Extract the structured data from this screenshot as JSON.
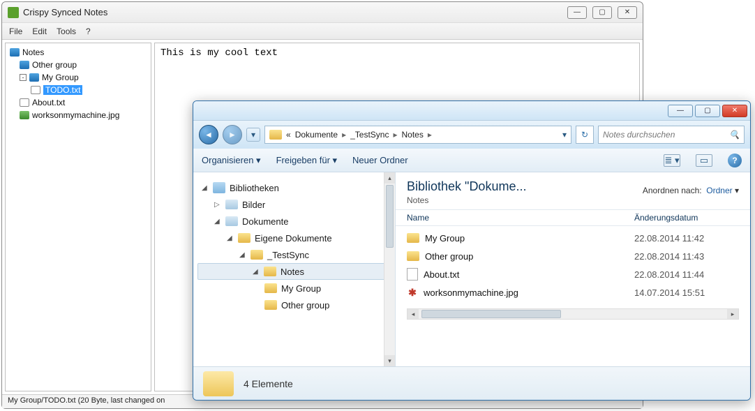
{
  "app": {
    "title": "Crispy Synced Notes",
    "menu": {
      "file": "File",
      "edit": "Edit",
      "tools": "Tools",
      "help": "?"
    },
    "tree": {
      "root": "Notes",
      "items": [
        {
          "label": "Other group"
        },
        {
          "label": "My Group"
        },
        {
          "label": "TODO.txt",
          "selected": true
        },
        {
          "label": "About.txt"
        },
        {
          "label": "worksonmymachine.jpg"
        }
      ]
    },
    "editor_text": "This is my cool text",
    "status": "My Group/TODO.txt (20 Byte, last changed on"
  },
  "explorer": {
    "breadcrumb": {
      "prefix": "«",
      "p1": "Dokumente",
      "p2": "_TestSync",
      "p3": "Notes"
    },
    "search_placeholder": "Notes durchsuchen",
    "toolbar": {
      "organize": "Organisieren",
      "share": "Freigeben für",
      "newfolder": "Neuer Ordner"
    },
    "nav_tree": {
      "libraries": "Bibliotheken",
      "pictures": "Bilder",
      "documents": "Dokumente",
      "own_docs": "Eigene Dokumente",
      "testsync": "_TestSync",
      "notes": "Notes",
      "mygroup": "My Group",
      "othergroup": "Other group"
    },
    "list": {
      "title": "Bibliothek \"Dokume...",
      "subtitle": "Notes",
      "sort_label": "Anordnen nach:",
      "sort_value": "Ordner",
      "col_name": "Name",
      "col_date": "Änderungsdatum",
      "rows": [
        {
          "name": "My Group",
          "date": "22.08.2014 11:42",
          "type": "folder"
        },
        {
          "name": "Other group",
          "date": "22.08.2014 11:43",
          "type": "folder"
        },
        {
          "name": "About.txt",
          "date": "22.08.2014 11:44",
          "type": "txt"
        },
        {
          "name": "worksonmymachine.jpg",
          "date": "14.07.2014 15:51",
          "type": "jpg"
        }
      ]
    },
    "status": "4 Elemente"
  }
}
